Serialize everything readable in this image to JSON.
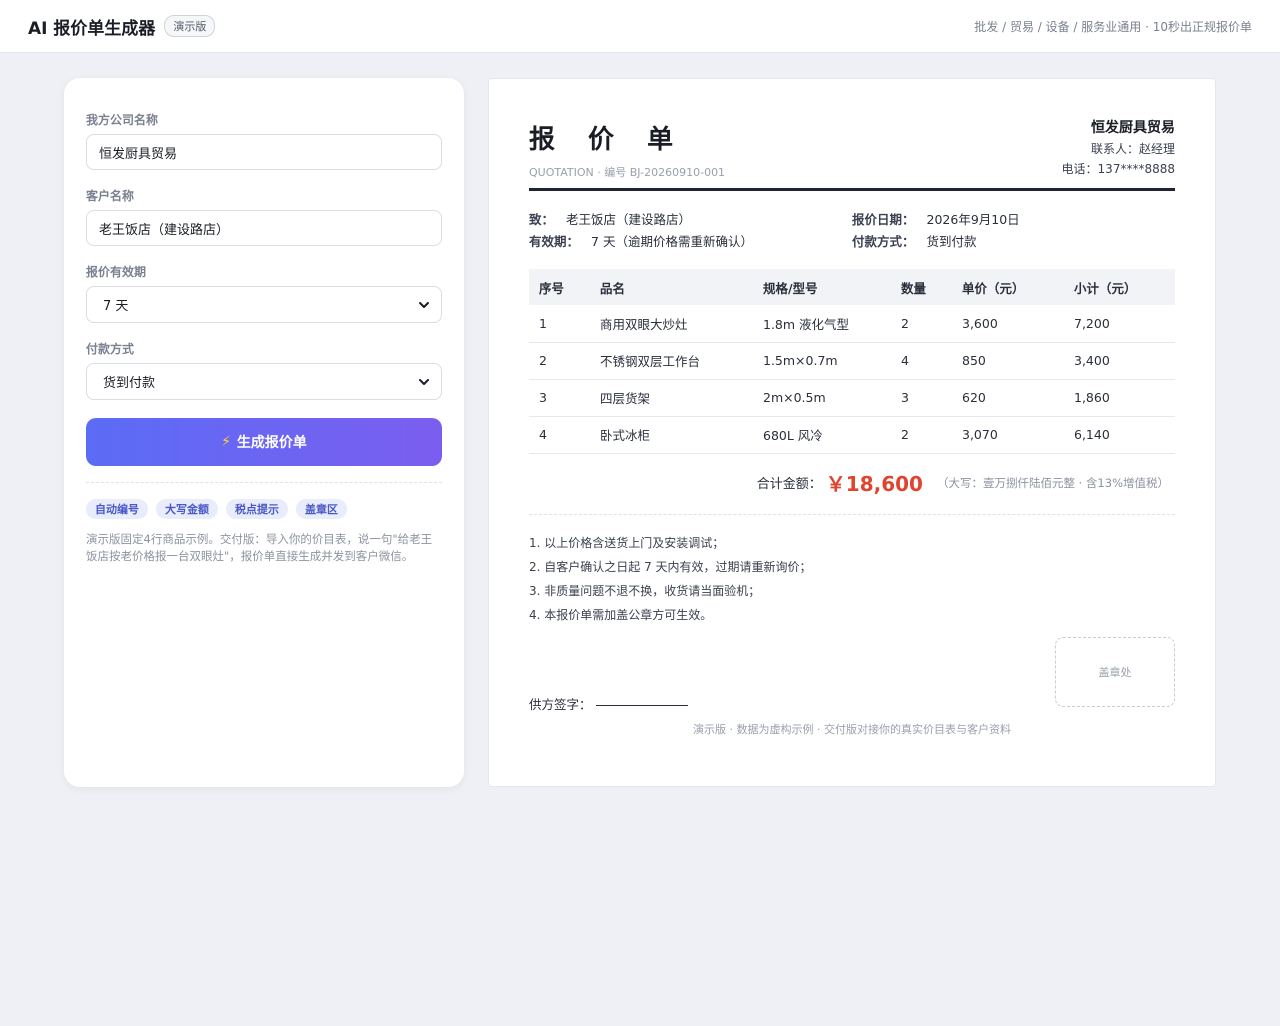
{
  "header": {
    "title": "AI 报价单生成器",
    "badge": "演示版",
    "tagline": "批发 / 贸易 / 设备 / 服务业通用 · 10秒出正规报价单"
  },
  "form": {
    "company_label": "我方公司名称",
    "company_value": "恒发厨具贸易",
    "client_label": "客户名称",
    "client_value": "老王饭店（建设路店）",
    "validity_label": "报价有效期",
    "validity_value": "7 天",
    "payment_label": "付款方式",
    "payment_value": "货到付款",
    "generate_label": "生成报价单",
    "chips": [
      "自动编号",
      "大写金额",
      "税点提示",
      "盖章区"
    ],
    "note": "演示版固定4行商品示例。交付版：导入你的价目表，说一句\"给老王饭店按老价格报一台双眼灶\"，报价单直接生成并发到客户微信。"
  },
  "quote": {
    "title": "报 价 单",
    "subtitle": "QUOTATION · 编号 BJ-20260910-001",
    "company": "恒发厨具贸易",
    "contact": "联系人：赵经理",
    "phone": "电话：137****8888",
    "to_label": "致：",
    "to_value": "老王饭店（建设路店）",
    "validity_label": "有效期：",
    "validity_value": "7 天（逾期价格需重新确认）",
    "date_label": "报价日期：",
    "date_value": "2026年9月10日",
    "payment_label": "付款方式：",
    "payment_value": "货到付款",
    "columns": [
      "序号",
      "品名",
      "规格/型号",
      "数量",
      "单价（元）",
      "小计（元）"
    ],
    "rows": [
      [
        "1",
        "商用双眼大炒灶",
        "1.8m 液化气型",
        "2",
        "3,600",
        "7,200"
      ],
      [
        "2",
        "不锈钢双层工作台",
        "1.5m×0.7m",
        "4",
        "850",
        "3,400"
      ],
      [
        "3",
        "四层货架",
        "2m×0.5m",
        "3",
        "620",
        "1,860"
      ],
      [
        "4",
        "卧式冰柜",
        "680L 风冷",
        "2",
        "3,070",
        "6,140"
      ]
    ],
    "total_label": "合计金额：",
    "total_value": "￥18,600",
    "total_caption": "（大写：壹万捌仟陆佰元整 · 含13%增值税）",
    "terms": [
      "1. 以上价格含送货上门及安装调试；",
      "2. 自客户确认之日起 7 天内有效，过期请重新询价；",
      "3. 非质量问题不退不换，收货请当面验机；",
      "4. 本报价单需加盖公章方可生效。"
    ],
    "signature_label": "供方签字：",
    "stamp_label": "盖章处",
    "footnote": "演示版 · 数据为虚构示例 · 交付版对接你的真实价目表与客户资料"
  }
}
